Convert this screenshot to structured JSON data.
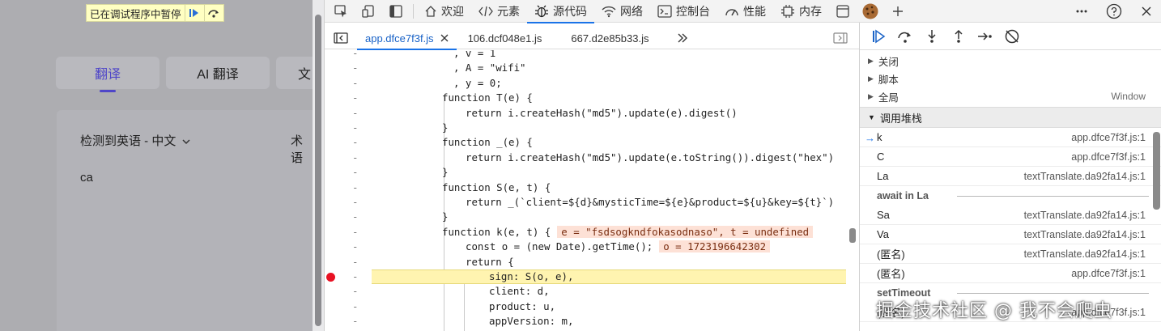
{
  "page": {
    "paused_text": "已在调试程序中暂停",
    "tabs": [
      {
        "label": "翻译",
        "active": true
      },
      {
        "label": "AI 翻译",
        "active": false
      },
      {
        "label": "文",
        "active": false
      }
    ],
    "language_label": "检测到英语 - 中文",
    "term_label": "术语",
    "input_text": "ca"
  },
  "devtools": {
    "main_tabs": [
      {
        "label": "欢迎",
        "icon": "home-icon"
      },
      {
        "label": "元素",
        "icon": "code-tag-icon"
      },
      {
        "label": "源代码",
        "icon": "bug-icon",
        "active": true
      },
      {
        "label": "网络",
        "icon": "wifi-icon"
      },
      {
        "label": "控制台",
        "icon": "console-icon"
      },
      {
        "label": "性能",
        "icon": "performance-icon"
      },
      {
        "label": "内存",
        "icon": "memory-icon"
      }
    ],
    "file_tabs": [
      {
        "label": "app.dfce7f3f.js",
        "active": true,
        "closable": true
      },
      {
        "label": "106.dcf048e1.js",
        "active": false
      },
      {
        "label": "667.d2e85b33.js",
        "active": false
      }
    ],
    "code_lines": [
      {
        "marker": "-",
        "text": ", v = 1"
      },
      {
        "marker": "-",
        "text": ", A = \"wifi\""
      },
      {
        "marker": "-",
        "text": ", y = 0;"
      },
      {
        "marker": "-",
        "text": "function T(e) {"
      },
      {
        "marker": "-",
        "text": "return i.createHash(\"md5\").update(e).digest()"
      },
      {
        "marker": "-",
        "text": "}"
      },
      {
        "marker": "-",
        "text": "function _(e) {"
      },
      {
        "marker": "-",
        "text": "return i.createHash(\"md5\").update(e.toString()).digest(\"hex\")"
      },
      {
        "marker": "-",
        "text": "}"
      },
      {
        "marker": "-",
        "text": "function S(e, t) {"
      },
      {
        "marker": "-",
        "text": "return _(`client=${d}&mysticTime=${e}&product=${u}&key=${t}`)"
      },
      {
        "marker": "-",
        "text": "}"
      },
      {
        "marker": "-",
        "text": "function k(e, t) {",
        "inline": "e = \"fsdsogkndfokasodnaso\", t = undefined"
      },
      {
        "marker": "-",
        "text": "const o = (new Date).getTime();",
        "inline": "o = 1723196642302"
      },
      {
        "marker": "-",
        "text": "return {"
      },
      {
        "marker": "-",
        "text": "sign: S(o, e),",
        "breakpoint": true,
        "highlight": true
      },
      {
        "marker": "-",
        "text": "client: d,"
      },
      {
        "marker": "-",
        "text": "product: u,"
      },
      {
        "marker": "-",
        "text": "appVersion: m,"
      }
    ],
    "scope_sections": [
      {
        "label": "关闭",
        "right": ""
      },
      {
        "label": "脚本",
        "right": ""
      },
      {
        "label": "全局",
        "right": "Window"
      }
    ],
    "call_stack_title": "调用堆栈",
    "call_stack": [
      {
        "kind": "frame",
        "name": "k",
        "loc": "app.dfce7f3f.js:1",
        "current": true
      },
      {
        "kind": "frame",
        "name": "C",
        "loc": "app.dfce7f3f.js:1"
      },
      {
        "kind": "frame",
        "name": "La",
        "loc": "textTranslate.da92fa14.js:1"
      },
      {
        "kind": "async",
        "name": "await in La"
      },
      {
        "kind": "frame",
        "name": "Sa",
        "loc": "textTranslate.da92fa14.js:1"
      },
      {
        "kind": "frame",
        "name": "Va",
        "loc": "textTranslate.da92fa14.js:1"
      },
      {
        "kind": "frame",
        "name": "(匿名)",
        "loc": "textTranslate.da92fa14.js:1"
      },
      {
        "kind": "frame",
        "name": "(匿名)",
        "loc": "app.dfce7f3f.js:1"
      },
      {
        "kind": "async",
        "name": "setTimeout"
      },
      {
        "kind": "frame",
        "name": "(匿名)",
        "loc": "app.dfce7f3f.js:1"
      }
    ]
  },
  "watermark": "掘金技术社区 @ 我不会爬虫"
}
